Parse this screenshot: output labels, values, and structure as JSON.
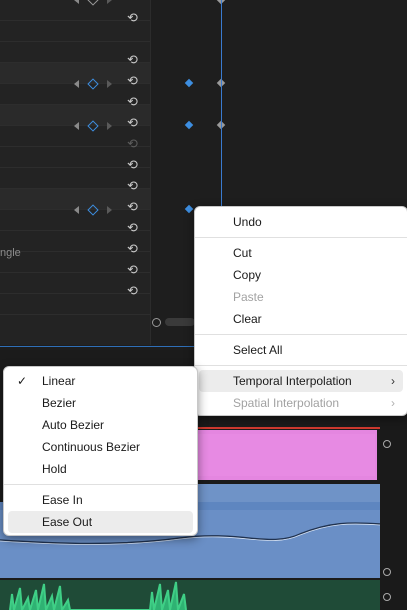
{
  "context_menu": {
    "items": [
      {
        "label": "Undo",
        "enabled": true
      },
      {
        "label": "Cut",
        "enabled": true
      },
      {
        "label": "Copy",
        "enabled": true
      },
      {
        "label": "Paste",
        "enabled": false
      },
      {
        "label": "Clear",
        "enabled": true
      },
      {
        "label": "Select All",
        "enabled": true
      },
      {
        "label": "Temporal Interpolation",
        "enabled": true,
        "submenu": true
      },
      {
        "label": "Spatial Interpolation",
        "enabled": false,
        "submenu": true
      }
    ]
  },
  "interpolation_submenu": {
    "items": [
      {
        "label": "Linear",
        "checked": true
      },
      {
        "label": "Bezier",
        "checked": false
      },
      {
        "label": "Auto Bezier",
        "checked": false
      },
      {
        "label": "Continuous Bezier",
        "checked": false
      },
      {
        "label": "Hold",
        "checked": false
      },
      {
        "label": "Ease In",
        "checked": false
      },
      {
        "label": "Ease Out",
        "checked": false
      }
    ]
  },
  "effect_controls": {
    "partial_label": "ngle"
  },
  "icons": {
    "reset": "reset-icon",
    "check": "checkmark-icon",
    "submenu": "chevron-right-icon"
  },
  "glyphs": {
    "reset": "⟲",
    "check": "✓",
    "chevron": "›"
  },
  "colors": {
    "keyframe_active": "#3d8ee0",
    "keyframe_inactive": "#9a9a9a",
    "playhead": "#3a7bd0",
    "clip_pink": "#e486e0",
    "clip_audio": "#6a8fc6"
  }
}
